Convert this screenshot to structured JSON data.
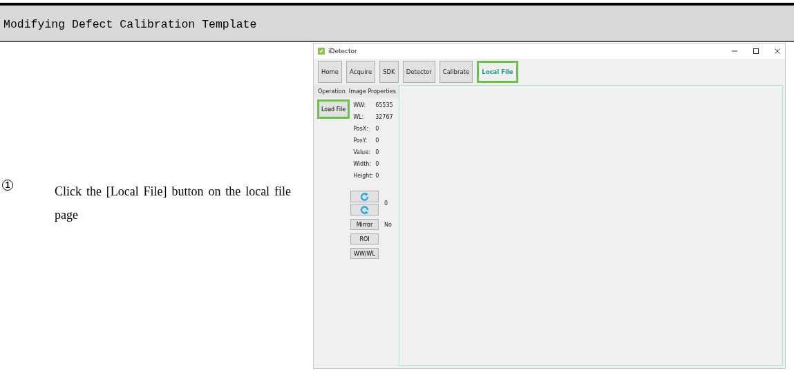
{
  "section_title": "Modifying Defect Calibration Template",
  "step": {
    "number": "1",
    "text": "Click the [Local File] button on the local file page"
  },
  "window": {
    "title": "iDetector"
  },
  "tabs": [
    {
      "label": "Home",
      "selected": false,
      "highlighted": false
    },
    {
      "label": "Acquire",
      "selected": false,
      "highlighted": false
    },
    {
      "label": "SDK",
      "selected": false,
      "highlighted": false
    },
    {
      "label": "Detector",
      "selected": false,
      "highlighted": false
    },
    {
      "label": "Calibrate",
      "selected": false,
      "highlighted": false
    },
    {
      "label": "Local File",
      "selected": true,
      "highlighted": true
    }
  ],
  "panel_headers": [
    "Operation",
    "Image Properties"
  ],
  "load_button": {
    "label": "Load File",
    "highlighted": true
  },
  "properties": [
    {
      "label": "WW:",
      "value": "65535"
    },
    {
      "label": "WL:",
      "value": "32767"
    },
    {
      "label": "PosX:",
      "value": "0"
    },
    {
      "label": "PosY:",
      "value": "0"
    },
    {
      "label": "Value:",
      "value": "0"
    },
    {
      "label": "Width:",
      "value": "0"
    },
    {
      "label": "Height:",
      "value": "0"
    }
  ],
  "rotation": "0",
  "mirror": {
    "label": "Mirror",
    "value": "No"
  },
  "buttons": [
    "ROI",
    "WW/WL"
  ]
}
